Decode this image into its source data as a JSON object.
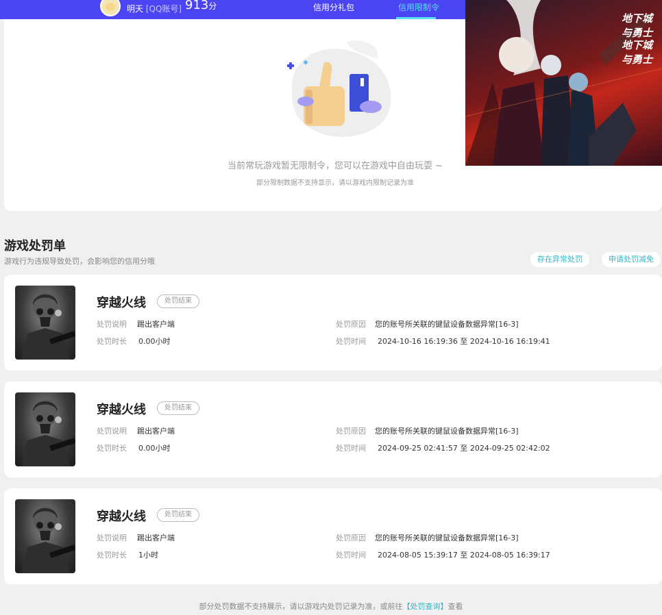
{
  "header": {
    "user_name": "明天",
    "account_type": "[QQ账号]",
    "credit_score": "913",
    "score_unit": "分",
    "tabs": [
      {
        "label": "信用分礼包",
        "active": false
      },
      {
        "label": "信用限制令",
        "active": true
      }
    ]
  },
  "empty_state": {
    "title": "当前常玩游戏暂无限制令，您可以在游戏中自由玩耍 ~",
    "subtitle": "部分限制数据不支持显示，请以游戏内限制记录为准"
  },
  "section": {
    "title": "游戏处罚单",
    "subtitle": "游戏行为违规导致处罚，会影响您的信用分哦",
    "buttons": [
      "存在异常处罚",
      "申请处罚减免"
    ]
  },
  "penalties": [
    {
      "game": "穿越火线",
      "status": "处罚结束",
      "desc_label": "处罚说明",
      "desc": "踢出客户端",
      "duration_label": "处罚时长",
      "duration": "0.00小时",
      "reason_label": "处罚原因",
      "reason": "您的账号所关联的键鼠设备数据异常[16-3]",
      "time_label": "处罚时间",
      "time": "2024-10-16 16:19:36 至 2024-10-16 16:19:41"
    },
    {
      "game": "穿越火线",
      "status": "处罚结束",
      "desc_label": "处罚说明",
      "desc": "踢出客户端",
      "duration_label": "处罚时长",
      "duration": "0.00小时",
      "reason_label": "处罚原因",
      "reason": "您的账号所关联的键鼠设备数据异常[16-3]",
      "time_label": "处罚时间",
      "time": "2024-09-25 02:41:57 至 2024-09-25 02:42:02"
    },
    {
      "game": "穿越火线",
      "status": "处罚结束",
      "desc_label": "处罚说明",
      "desc": "踢出客户端",
      "duration_label": "处罚时长",
      "duration": "1小时",
      "reason_label": "处罚原因",
      "reason": "您的账号所关联的键鼠设备数据异常[16-3]",
      "time_label": "处罚时间",
      "time": "2024-08-05 15:39:17 至 2024-08-05 16:39:17"
    }
  ],
  "ad": {
    "logos": [
      "地下城与勇士",
      "地下城与勇士"
    ]
  },
  "footer": {
    "text_before": "部分处罚数据不支持展示，请以游戏内处罚记录为准，或前往",
    "link": "【处罚查询】",
    "text_after": "查看"
  },
  "colors": {
    "header_bg": "#4b44f2",
    "accent": "#2fb7c8",
    "active_tab": "#54e0f0"
  }
}
